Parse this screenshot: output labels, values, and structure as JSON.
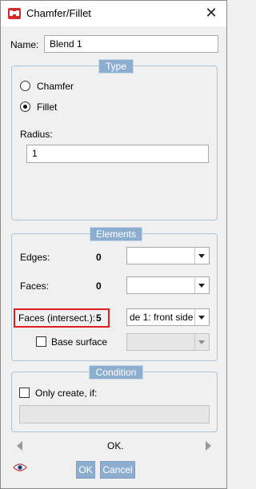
{
  "window": {
    "title": "Chamfer/Fillet",
    "accent_color": "#8eaed0",
    "highlight_color": "#e02020"
  },
  "name_field": {
    "label": "Name:",
    "value": "Blend 1"
  },
  "type_group": {
    "legend": "Type",
    "options": [
      {
        "label": "Chamfer",
        "selected": false
      },
      {
        "label": "Fillet",
        "selected": true
      }
    ],
    "radius_label": "Radius:",
    "radius_value": "1"
  },
  "elements_group": {
    "legend": "Elements",
    "edges": {
      "label": "Edges:",
      "count": "0",
      "selected": ""
    },
    "faces": {
      "label": "Faces:",
      "count": "0",
      "selected": ""
    },
    "faces_intersect": {
      "label": "Faces (intersect.):",
      "count": "5",
      "selected": "de 1: front side"
    },
    "base_surface": {
      "label": "Base surface",
      "checked": false,
      "selected": ""
    }
  },
  "condition_group": {
    "legend": "Condition",
    "only_create_label": "Only create, if:",
    "only_create_checked": false,
    "condition_value": ""
  },
  "footer": {
    "nav_text": "OK.",
    "ok_label": "OK",
    "cancel_label": "Cancel"
  },
  "icons": [
    "app-icon",
    "close-icon",
    "eye-icon",
    "nav-left-arrow",
    "nav-right-arrow",
    "dropdown-arrow"
  ]
}
